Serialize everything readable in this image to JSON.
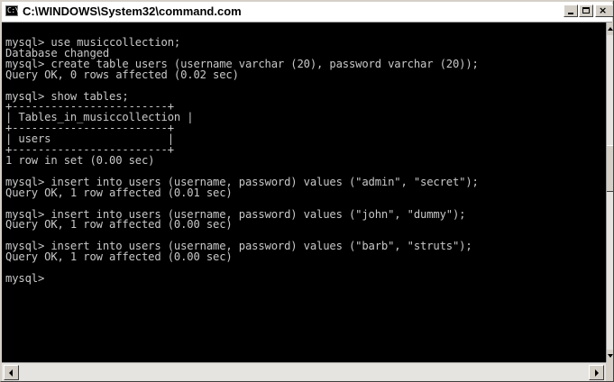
{
  "window": {
    "title": "C:\\WINDOWS\\System32\\command.com",
    "icon_text": "C:\\",
    "close_glyph": "×"
  },
  "console": {
    "lines": [
      "mysql> use musiccollection;",
      "Database changed",
      "mysql> create table users (username varchar (20), password varchar (20));",
      "Query OK, 0 rows affected (0.02 sec)",
      "",
      "mysql> show tables;",
      "+------------------------+",
      "| Tables_in_musiccollection |",
      "+------------------------+",
      "| users                  |",
      "+------------------------+",
      "1 row in set (0.00 sec)",
      "",
      "mysql> insert into users (username, password) values (\"admin\", \"secret\");",
      "Query OK, 1 row affected (0.01 sec)",
      "",
      "mysql> insert into users (username, password) values (\"john\", \"dummy\");",
      "Query OK, 1 row affected (0.00 sec)",
      "",
      "mysql> insert into users (username, password) values (\"barb\", \"struts\");",
      "Query OK, 1 row affected (0.00 sec)",
      "",
      "mysql>"
    ]
  },
  "colors": {
    "console_bg": "#000000",
    "console_fg": "#c8c8c8",
    "chrome": "#d4d0c8"
  },
  "icons": {
    "app": "console-icon",
    "minimize": "minimize-icon",
    "maximize": "maximize-icon",
    "close": "close-icon"
  }
}
